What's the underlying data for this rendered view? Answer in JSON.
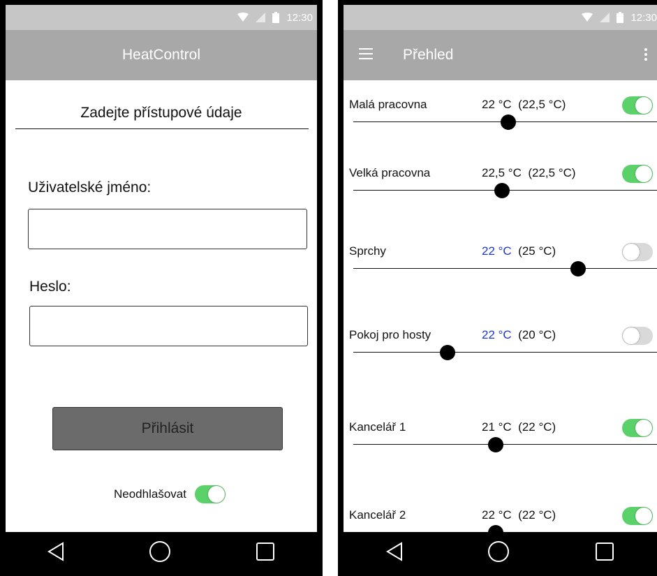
{
  "status_time": "12:30",
  "login_screen": {
    "app_title": "HeatControl",
    "heading": "Zadejte přístupové údaje",
    "username_label": "Uživatelské jméno:",
    "username_value": "",
    "password_label": "Heslo:",
    "password_value": "",
    "login_button": "Přihlásit",
    "remember_label": "Neodhlašovat",
    "remember_on": true
  },
  "overview_screen": {
    "title": "Přehled",
    "rooms": [
      {
        "name": "Malá pracovna",
        "current": "22 °C",
        "target": "(22,5 °C)",
        "current_highlight": false,
        "enabled": true,
        "slider_fraction": 0.51
      },
      {
        "name": "Velká pracovna",
        "current": "22,5 °C",
        "target": "(22,5 °C)",
        "current_highlight": false,
        "enabled": true,
        "slider_fraction": 0.49
      },
      {
        "name": "Sprchy",
        "current": "22 °C",
        "target": "(25 °C)",
        "current_highlight": true,
        "enabled": false,
        "slider_fraction": 0.74
      },
      {
        "name": "Pokoj pro hosty",
        "current": "22 °C",
        "target": "(20 °C)",
        "current_highlight": true,
        "enabled": false,
        "slider_fraction": 0.31
      },
      {
        "name": "Kancelář 1",
        "current": "21 °C",
        "target": "(22 °C)",
        "current_highlight": false,
        "enabled": true,
        "slider_fraction": 0.47
      },
      {
        "name": "Kancelář 2",
        "current": "22 °C",
        "target": "(22 °C)",
        "current_highlight": false,
        "enabled": true,
        "slider_fraction": 0.47
      }
    ]
  },
  "colors": {
    "switch_on": "#5bd16a",
    "highlight_temp": "#1b36d6"
  },
  "icons": [
    "wifi-icon",
    "signal-icon",
    "battery-icon",
    "back-icon",
    "home-icon",
    "recents-icon",
    "menu-icon",
    "more-vert-icon"
  ]
}
